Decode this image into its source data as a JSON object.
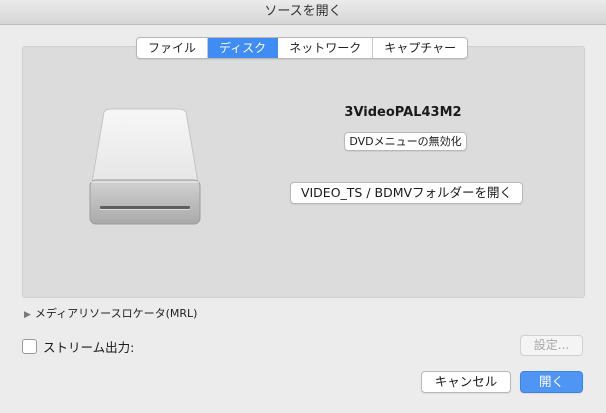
{
  "window": {
    "title": "ソースを開く"
  },
  "tabs": [
    {
      "label": "ファイル",
      "active": false
    },
    {
      "label": "ディスク",
      "active": true
    },
    {
      "label": "ネットワーク",
      "active": false
    },
    {
      "label": "キャプチャー",
      "active": false
    }
  ],
  "disc": {
    "icon": "external-drive-icon",
    "name": "3VideoPAL43M2",
    "dvd_menu_button": "DVDメニューの無効化",
    "open_folder_button": "VIDEO_TS / BDMVフォルダーを開く"
  },
  "mrl": {
    "label": "メディアリソースロケータ(MRL)",
    "expanded": false
  },
  "stream_output": {
    "label": "ストリーム出力:",
    "checked": false,
    "settings_button": "設定..."
  },
  "footer": {
    "cancel_label": "キャンセル",
    "open_label": "開く"
  },
  "colors": {
    "accent": "#3f8cf3",
    "panel": "#dcdcdc",
    "window": "#ececec"
  }
}
